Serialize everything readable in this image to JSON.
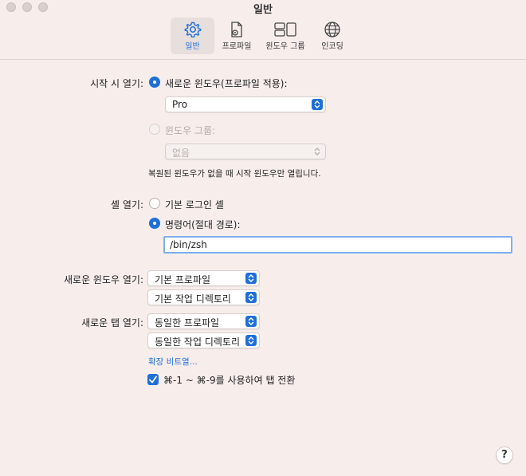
{
  "window": {
    "title": "일반"
  },
  "toolbar": {
    "tabs": [
      {
        "label": "일반",
        "icon": "gear-icon",
        "active": true
      },
      {
        "label": "프로파일",
        "icon": "profile-document-icon",
        "active": false
      },
      {
        "label": "윈도우 그룹",
        "icon": "window-group-icon",
        "active": false
      },
      {
        "label": "인코딩",
        "icon": "globe-icon",
        "active": false
      }
    ]
  },
  "startup": {
    "label": "시작 시 열기:",
    "new_window_option": "새로운 윈도우(프로파일 적용):",
    "new_window_selected": true,
    "profile_value": "Pro",
    "window_group_option": "윈도우 그룹:",
    "window_group_selected": false,
    "window_group_value": "없음",
    "note": "복원된 윈도우가 없을 때 시작 윈도우만 열립니다."
  },
  "shell": {
    "label": "셸 열기:",
    "login_shell_option": "기본 로그인 셸",
    "login_shell_selected": false,
    "command_option": "명령어(절대 경로):",
    "command_selected": true,
    "command_value": "/bin/zsh"
  },
  "new_window": {
    "label": "새로운 윈도우 열기:",
    "profile_value": "기본 프로파일",
    "directory_value": "기본 작업 디렉토리"
  },
  "new_tab": {
    "label": "새로운 탭 열기:",
    "profile_value": "동일한 프로파일",
    "directory_value": "동일한 작업 디렉토리",
    "advanced_link": "확장 비트열...",
    "shortcut_checkbox_label": "⌘-1 ~ ⌘-9를 사용하여 탭 전환",
    "shortcut_checked": true
  },
  "help": {
    "label": "?"
  },
  "colors": {
    "accent": "#1f6fd9",
    "background": "#f7eeec"
  }
}
